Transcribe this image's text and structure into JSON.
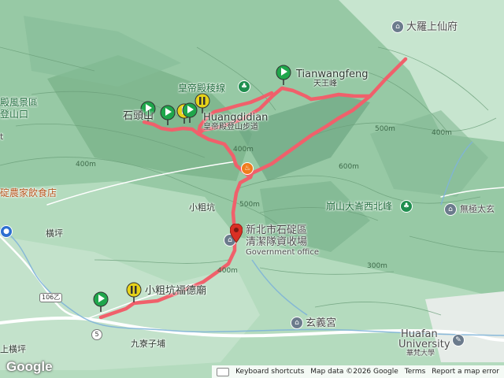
{
  "map": {
    "labels": {
      "dalishangxianfu": "大羅上仙府",
      "tianwangfeng_en": "Tianwangfeng",
      "tianwangfeng_zh": "天王峰",
      "huangdi_line": "皇帝殿稜線",
      "shitoushan": "石頭山",
      "huangdidian_en": "Huangdidian",
      "huangdi_trail": "皇帝殿登山步道",
      "fengjingqu": "殿風景區",
      "dengshankou": "登山口",
      "farm_restaurant": "碇農家飲食店",
      "xiaocukeng": "小粗坑",
      "hengping": "橫坪",
      "shangnanhengping": "上橫坪",
      "shiding_office_1": "新北市石碇區",
      "shiding_office_2": "清潔隊資收場",
      "government_office": "Government office",
      "dalun_west_peak": "崩山大崙西北峰",
      "wuji_taisuan": "無極太玄",
      "xiaocukeng_temple": "小粗坑福德廟",
      "xuanyi_gong": "玄義宮",
      "jiuliaozipu": "九寮子埔",
      "huafan_en_1": "Huafan",
      "huafan_en_2": "University",
      "huafan_zh": "華梵大學",
      "fragment_t": "t",
      "road_106": "106乙",
      "road_5": "5",
      "contour_400_a": "400m",
      "contour_400_b": "400m",
      "contour_400_c": "400m",
      "contour_400_d": "400m",
      "contour_500_a": "500m",
      "contour_500_b": "500m",
      "contour_600": "600m",
      "contour_300": "300m"
    },
    "icons": [
      "temple-icon",
      "park-icon",
      "restaurant-icon",
      "government-icon",
      "university-icon",
      "pin-icon",
      "flag-icon"
    ],
    "colors": {
      "track": "#f0606b",
      "terrain_dark": "#5f9a73",
      "terrain_light": "#b8dcc2",
      "flag_green": "#1fa64b",
      "flag_yellow": "#e6d21a",
      "pin_red": "#d93025",
      "poi_green": "#1e8e4e"
    }
  },
  "footer": {
    "keyboard_shortcuts": "Keyboard shortcuts",
    "map_data": "Map data ©2026 Google",
    "terms": "Terms",
    "report": "Report a map error"
  },
  "brand": {
    "logo": "Google"
  }
}
